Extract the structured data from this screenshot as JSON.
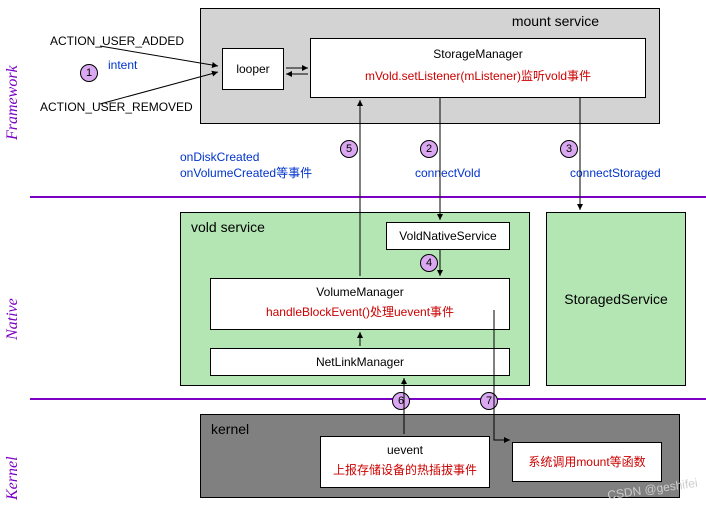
{
  "layers": {
    "framework": "Framework",
    "native": "Native",
    "kernel": "Kernel"
  },
  "boxes": {
    "mount_service": "mount service",
    "looper": "looper",
    "storage_manager": {
      "title": "StorageManager",
      "detail": "mVold.setListener(mListener)监听vold事件"
    },
    "vold_service": "vold service",
    "vold_native_service": "VoldNativeService",
    "volume_manager": {
      "title": "VolumeManager",
      "detail": "handleBlockEvent()处理uevent事件"
    },
    "netlink_manager": "NetLinkManager",
    "storaged_service": "StoragedService",
    "kernel": "kernel",
    "uevent": {
      "title": "uevent",
      "detail": "上报存储设备的热插拔事件"
    },
    "syscall": "系统调用mount等函数"
  },
  "labels": {
    "action_added": "ACTION_USER_ADDED",
    "action_removed": "ACTION_USER_REMOVED",
    "intent": "intent",
    "events": "onDiskCreated\nonVolumeCreated等事件",
    "connect_vold": "connectVold",
    "connect_storaged": "connectStoraged"
  },
  "badges": {
    "1": "1",
    "2": "2",
    "3": "3",
    "4": "4",
    "5": "5",
    "6": "6",
    "7": "7"
  },
  "watermark": "CSDN @geshifei"
}
